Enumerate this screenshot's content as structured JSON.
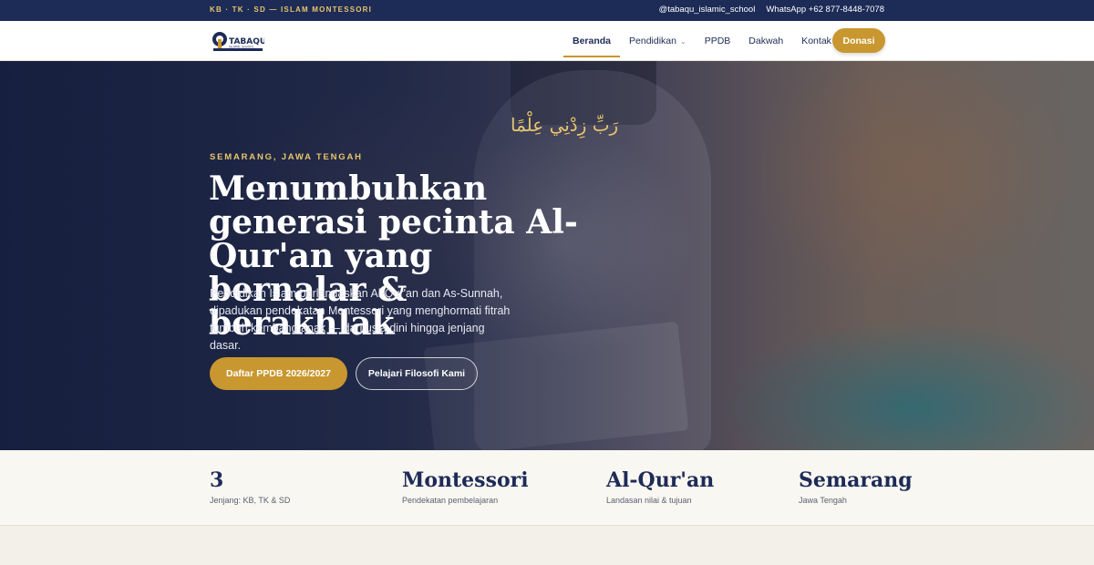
{
  "topbar": {
    "tagline": "KB · TK · SD — ISLAM MONTESSORI",
    "instagram": "@tabaqu_islamic_school",
    "whatsapp": "WhatsApp +62 877-8448-7078"
  },
  "nav": {
    "logo_text": "TABAQU",
    "logo_sub": "ISLAMIC SCHOOL",
    "links": [
      {
        "label": "Beranda",
        "active": true
      },
      {
        "label": "Pendidikan",
        "has_dropdown": true
      },
      {
        "label": "PPDB"
      },
      {
        "label": "Dakwah"
      },
      {
        "label": "Kontak"
      }
    ],
    "donate_label": "Donasi"
  },
  "hero": {
    "arabic": "رَبِّ زِدْنِي عِلْمًا",
    "eyebrow": "SEMARANG, JAWA TENGAH",
    "headline": "Menumbuhkan generasi pecinta Al-Qur'an yang bernalar & berakhlak",
    "lead": "Pendidikan Islam berlandaskan Al-Qur'an dan As-Sunnah, dipadukan pendekatan Montessori yang menghormati fitrah tumbuh kembang anak — dari usia dini hingga jenjang dasar.",
    "primary_cta": "Daftar PPDB 2026/2027",
    "secondary_cta": "Pelajari Filosofi Kami"
  },
  "stats": [
    {
      "value": "3",
      "label": "Jenjang: KB, TK & SD"
    },
    {
      "value": "Montessori",
      "label": "Pendekatan pembelajaran"
    },
    {
      "value": "Al-Qur'an",
      "label": "Landasan nilai & tujuan"
    },
    {
      "value": "Semarang",
      "label": "Jawa Tengah"
    }
  ],
  "colors": {
    "navy": "#1d2b57",
    "gold": "#c9972f",
    "cream": "#f9f7f1"
  }
}
